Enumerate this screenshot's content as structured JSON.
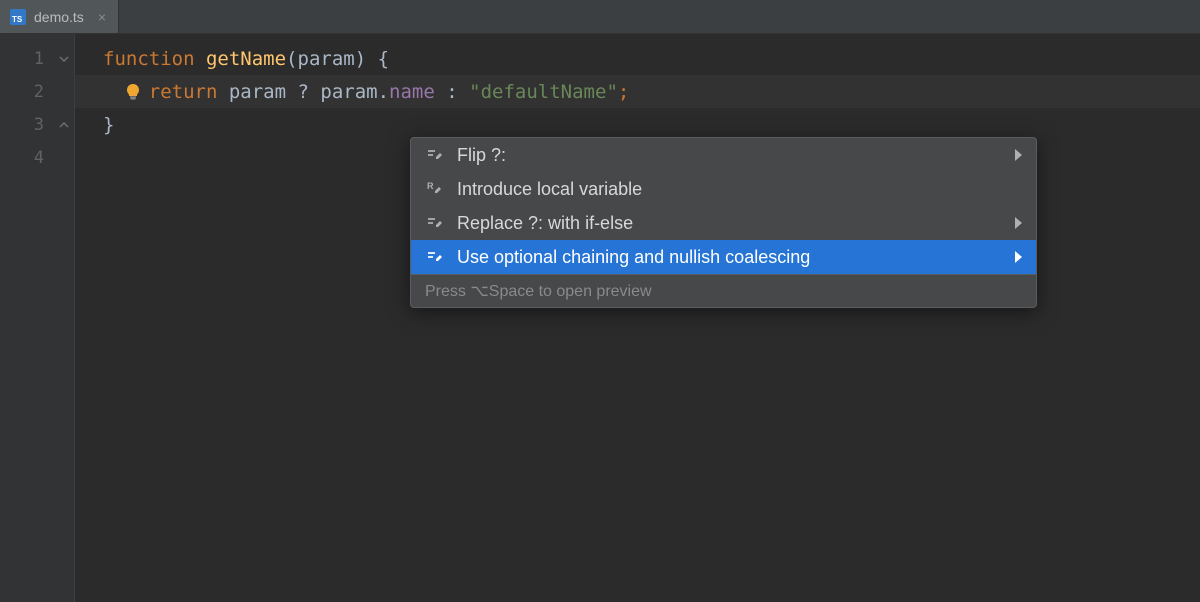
{
  "tab": {
    "filename": "demo.ts",
    "icon": "ts-file-icon"
  },
  "gutter": {
    "lines": [
      "1",
      "2",
      "3",
      "4"
    ]
  },
  "code": {
    "line1": {
      "kw1": "function",
      "fn": "getName",
      "paren_open": "(",
      "param": "param",
      "paren_close": ")",
      "brace": " {"
    },
    "line2": {
      "indent": "    ",
      "kw": "return ",
      "id1": "param ",
      "q": "?",
      "sp1": " ",
      "id2": "param",
      "dot": ".",
      "prop": "name",
      "sp2": " ",
      "colon": ":",
      "sp3": " ",
      "str": "\"defaultName\"",
      "semi": ";"
    },
    "line3": {
      "brace": "}"
    }
  },
  "intention": {
    "items": [
      {
        "icon": "edit-icon",
        "label": "Flip ?:",
        "arrow": true
      },
      {
        "icon": "refactor-icon",
        "label": "Introduce local variable",
        "arrow": false
      },
      {
        "icon": "edit-icon",
        "label": "Replace ?: with if-else",
        "arrow": true
      },
      {
        "icon": "edit-icon",
        "label": "Use optional chaining and nullish coalescing",
        "arrow": true,
        "selected": true
      }
    ],
    "footer": "Press ⌥Space to open preview"
  }
}
